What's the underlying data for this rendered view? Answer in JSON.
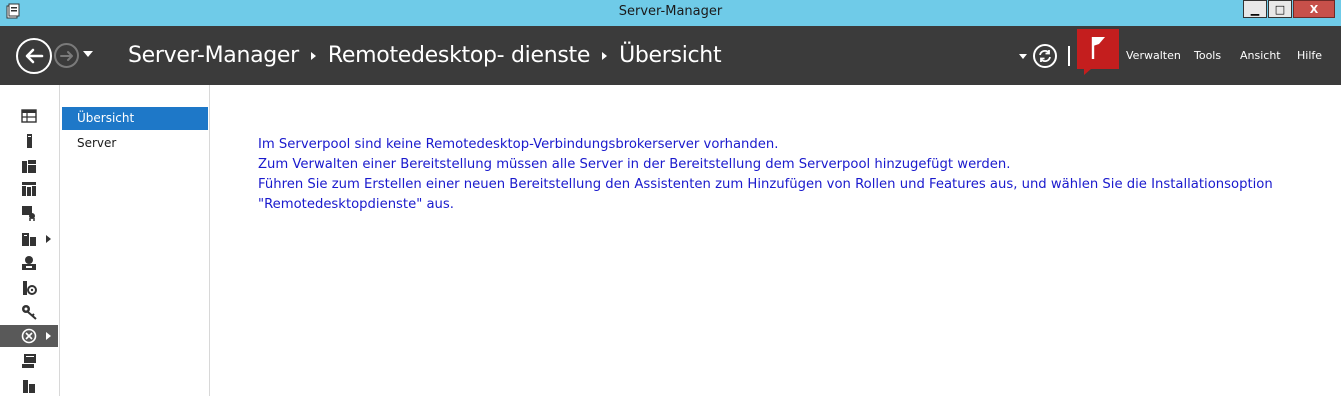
{
  "window": {
    "title": "Server-Manager",
    "controls": {
      "minimize": "▁",
      "maximize": "□",
      "close": "X"
    }
  },
  "header": {
    "breadcrumb": [
      "Server-Manager",
      "Remotedesktop- dienste",
      "Übersicht"
    ],
    "menu": [
      "Verwalten",
      "Tools",
      "Ansicht",
      "Hilfe"
    ],
    "flag_color": "#c41e1e",
    "background": "#3b3b3b"
  },
  "rail": {
    "icons": [
      "dashboard-icon",
      "local-server-icon",
      "all-servers-icon",
      "ad-icon",
      "certificate-icon",
      "file-services-icon",
      "hyper-v-icon",
      "print-icon",
      "remote-access-icon",
      "remote-desktop-icon",
      "server-roles-icon",
      "wsus-icon"
    ]
  },
  "subnav": {
    "items": [
      "Übersicht",
      "Server"
    ]
  },
  "main": {
    "message_lines": [
      "Im Serverpool sind keine Remotedesktop-Verbindungsbrokerserver vorhanden.",
      "Zum Verwalten einer Bereitstellung müssen alle Server in der Bereitstellung dem Serverpool hinzugefügt werden.",
      "Führen Sie zum Erstellen einer neuen Bereitstellung den Assistenten zum Hinzufügen von Rollen und Features aus, und wählen Sie die Installationsoption \"Remotedesktopdienste\" aus."
    ],
    "message_color": "#1a1acd"
  },
  "colors": {
    "titlebar": "#6fcbe8",
    "active_blue": "#1e78c8"
  }
}
